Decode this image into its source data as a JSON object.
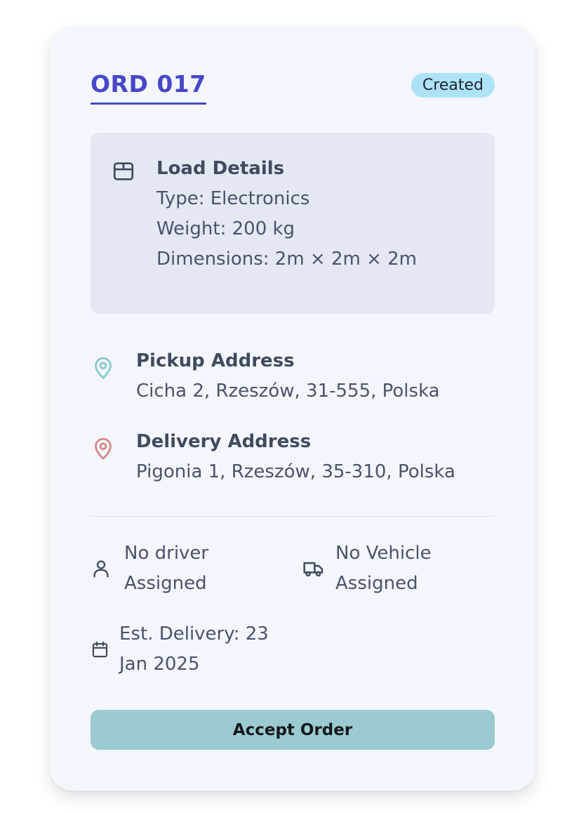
{
  "order": {
    "id": "ORD 017",
    "status": "Created"
  },
  "load": {
    "title": "Load Details",
    "type": "Type: Electronics",
    "weight": "Weight: 200 kg",
    "dimensions": "Dimensions: 2m × 2m × 2m",
    "icon": "package-icon"
  },
  "pickup": {
    "title": "Pickup Address",
    "address": "Cicha 2, Rzeszów, 31-555, Polska",
    "icon": "map-pin-icon"
  },
  "delivery": {
    "title": "Delivery Address",
    "address": "Pigonia 1, Rzeszów, 35-310, Polska",
    "icon": "map-pin-icon"
  },
  "driver": {
    "line1": "No driver",
    "line2": "Assigned",
    "icon": "user-icon"
  },
  "vehicle": {
    "line1": "No Vehicle",
    "line2": "Assigned",
    "icon": "truck-icon"
  },
  "est_delivery": {
    "line1": "Est. Delivery: 23",
    "line2": "Jan 2025",
    "icon": "calendar-icon"
  },
  "actions": {
    "accept_label": "Accept Order"
  },
  "colors": {
    "primary": "#4747c7",
    "status_bg": "#aee3f7",
    "pickup_pin": "#8cc9cc",
    "delivery_pin": "#d38a86",
    "button_bg": "#9bcbd0"
  }
}
